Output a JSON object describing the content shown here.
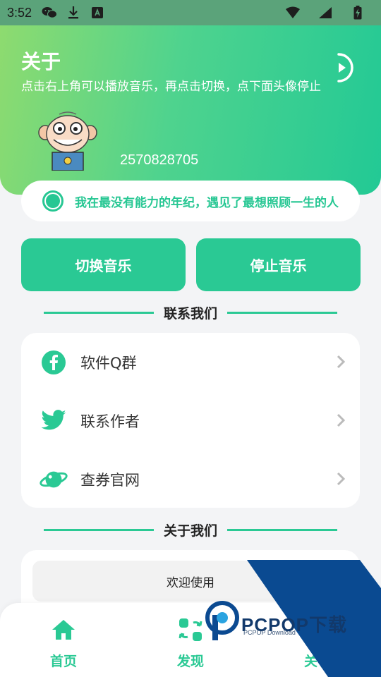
{
  "status_bar": {
    "time": "3:52",
    "left_icons": [
      "wechat-icon",
      "download-icon",
      "translate-icon"
    ],
    "right_icons": [
      "wifi-icon",
      "signal-icon",
      "battery-charging-icon"
    ]
  },
  "header": {
    "title": "关于",
    "subtitle": "点击右上角可以播放音乐，再点击切换，点下面头像停止",
    "qq": "2570828705",
    "play_icon": "play-icon"
  },
  "quote": {
    "text": "我在最没有能力的年纪，遇见了最想照顾一生的人"
  },
  "buttons": {
    "switch_music": "切换音乐",
    "stop_music": "停止音乐"
  },
  "contact_section": {
    "title": "联系我们",
    "items": [
      {
        "label": "软件Q群",
        "icon": "facebook-icon"
      },
      {
        "label": "联系作者",
        "icon": "twitter-icon"
      },
      {
        "label": "查券官网",
        "icon": "planet-icon"
      }
    ]
  },
  "about_section": {
    "title": "关于我们",
    "welcome": "欢迎使用"
  },
  "bottom_nav": {
    "items": [
      {
        "label": "首页",
        "icon": "home-icon"
      },
      {
        "label": "发现",
        "icon": "discover-icon"
      },
      {
        "label": "关于",
        "icon": "about-icon"
      }
    ]
  },
  "watermark": {
    "brand": "PCPOP下载",
    "sub": "PCPOP Download"
  },
  "colors": {
    "accent": "#2ac994",
    "header_start": "#8edb6f",
    "header_end": "#22c995",
    "statusbar": "#5ba37a"
  }
}
